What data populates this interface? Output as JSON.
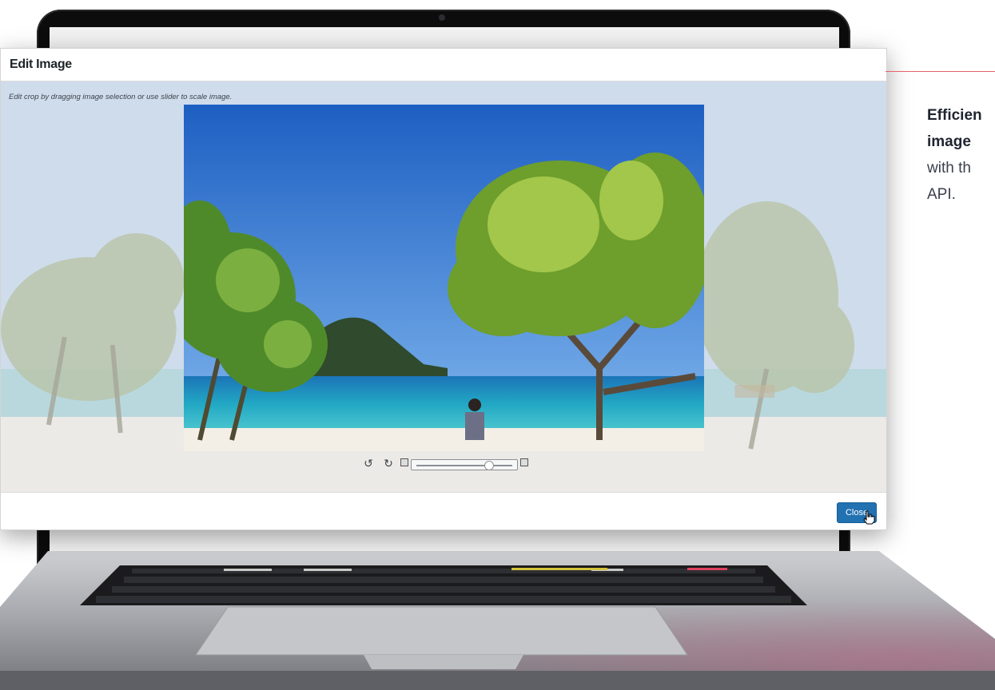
{
  "modal": {
    "title": "Edit Image",
    "hint": "Edit crop by dragging image selection or use slider to scale image.",
    "close_label": "Close"
  },
  "controls": {
    "rotate_left_icon": "rotate-left-icon",
    "rotate_right_icon": "rotate-right-icon",
    "zoom_out_icon": "zoom-out-icon",
    "zoom_in_icon": "zoom-in-icon",
    "zoom_level": 0.76
  },
  "side_copy": {
    "line1": "Efficien",
    "line2": "image",
    "line3": "with th",
    "line4": "API."
  },
  "colors": {
    "accent": "#2271b1",
    "rule": "#e4636a"
  }
}
